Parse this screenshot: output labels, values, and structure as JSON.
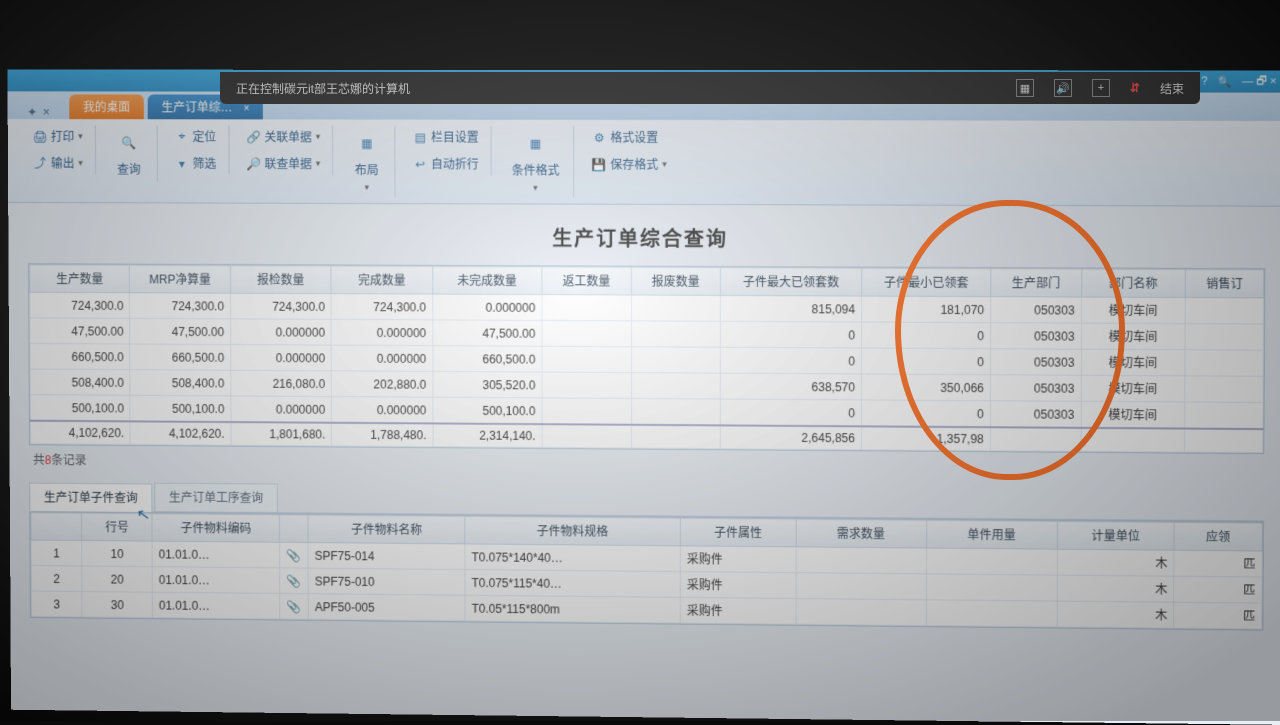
{
  "remote": {
    "status": "正在控制碳元it部王芯娜的计算机",
    "end": "结束"
  },
  "window": {
    "help": "?",
    "search": ""
  },
  "tabs": {
    "pin": "✦",
    "close_pin": "×",
    "desktop": "我的桌面",
    "report": "生产订单综…",
    "report_close": "×"
  },
  "toolbar": {
    "print": "打印",
    "export": "输出",
    "query": "查询",
    "locate": "定位",
    "filter": "筛选",
    "linkdoc": "关联单据",
    "lookup": "联查单据",
    "layout": "布局",
    "colset": "栏目设置",
    "autowrap": "自动折行",
    "condfmt": "条件格式",
    "fmtset": "格式设置",
    "savefmt": "保存格式"
  },
  "pageTitle": "生产订单综合查询",
  "mainGrid": {
    "headers": [
      "生产数量",
      "MRP净算量",
      "报检数量",
      "完成数量",
      "未完成数量",
      "返工数量",
      "报废数量",
      "子件最大已领套数",
      "子件最小已领套",
      "生产部门",
      "部门名称",
      "销售订"
    ],
    "rows": [
      [
        "724,300.0",
        "724,300.0",
        "724,300.0",
        "724,300.0",
        "0.000000",
        "",
        "",
        "815,094",
        "181,070",
        "050303",
        "模切车间",
        ""
      ],
      [
        "47,500.00",
        "47,500.00",
        "0.000000",
        "0.000000",
        "47,500.00",
        "",
        "",
        "0",
        "0",
        "050303",
        "模切车间",
        ""
      ],
      [
        "660,500.0",
        "660,500.0",
        "0.000000",
        "0.000000",
        "660,500.0",
        "",
        "",
        "0",
        "0",
        "050303",
        "模切车间",
        ""
      ],
      [
        "508,400.0",
        "508,400.0",
        "216,080.0",
        "202,880.0",
        "305,520.0",
        "",
        "",
        "638,570",
        "350,066",
        "050303",
        "模切车间",
        ""
      ],
      [
        "500,100.0",
        "500,100.0",
        "0.000000",
        "0.000000",
        "500,100.0",
        "",
        "",
        "0",
        "0",
        "050303",
        "模切车间",
        ""
      ]
    ],
    "sumRow": [
      "4,102,620.",
      "4,102,620.",
      "1,801,680.",
      "1,788,480.",
      "2,314,140.",
      "",
      "",
      "2,645,856",
      "1,357,98",
      "",
      "",
      ""
    ]
  },
  "recordCount": {
    "prefix": "共",
    "n": "8",
    "suffix": "条记录"
  },
  "subTabs": {
    "a": "生产订单子件查询",
    "b": "生产订单工序查询"
  },
  "subGrid": {
    "headers": [
      "",
      "行号",
      "子件物料编码",
      "",
      "子件物料名称",
      "子件物料规格",
      "子件属性",
      "需求数量",
      "单件用量",
      "计量单位",
      "应领"
    ],
    "rows": [
      [
        "1",
        "10",
        "01.01.0…",
        "📎",
        "SPF75-014",
        "T0.075*140*40…",
        "采购件",
        "",
        "",
        "木",
        "匹"
      ],
      [
        "2",
        "20",
        "01.01.0…",
        "📎",
        "SPF75-010",
        "T0.075*115*40…",
        "采购件",
        "",
        "",
        "木",
        "匹"
      ],
      [
        "3",
        "30",
        "01.01.0…",
        "📎",
        "APF50-005",
        "T0.05*115*800m",
        "采购件",
        "",
        "",
        "木",
        "匹"
      ]
    ]
  }
}
